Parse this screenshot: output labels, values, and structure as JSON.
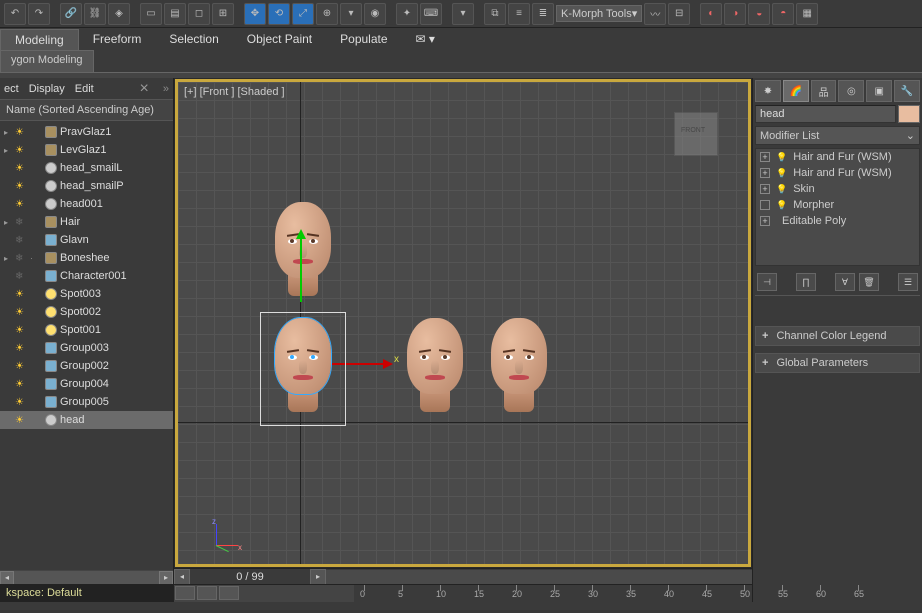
{
  "top_toolbar": {
    "dropdown": "K-Morph Tools"
  },
  "menubar": {
    "items": [
      "Modeling",
      "Freeform",
      "Selection",
      "Object Paint",
      "Populate"
    ]
  },
  "ribbon": {
    "tab": "ygon Modeling"
  },
  "left_panel": {
    "tabs": [
      "ect",
      "Display",
      "Edit"
    ],
    "header": "Name (Sorted Ascending Age)",
    "nodes": [
      {
        "name": "PravGlaz1",
        "icon": "bone",
        "bulb": "on",
        "exp": true
      },
      {
        "name": "LevGlaz1",
        "icon": "bone",
        "bulb": "on",
        "exp": true
      },
      {
        "name": "head_smailL",
        "icon": "geo",
        "bulb": "on",
        "exp": false
      },
      {
        "name": "head_smailP",
        "icon": "geo",
        "bulb": "on",
        "exp": false
      },
      {
        "name": "head001",
        "icon": "geo",
        "bulb": "on",
        "exp": false
      },
      {
        "name": "Hair",
        "icon": "bone",
        "bulb": "off",
        "exp": true
      },
      {
        "name": "Glavn",
        "icon": "grp",
        "bulb": "off",
        "exp": false
      },
      {
        "name": "Boneshee",
        "icon": "bone",
        "bulb": "off",
        "exp": true,
        "dim": true
      },
      {
        "name": "Character001",
        "icon": "grp",
        "bulb": "off",
        "exp": false
      },
      {
        "name": "Spot003",
        "icon": "spot",
        "bulb": "on",
        "exp": false
      },
      {
        "name": "Spot002",
        "icon": "spot",
        "bulb": "on",
        "exp": false
      },
      {
        "name": "Spot001",
        "icon": "spot",
        "bulb": "on",
        "exp": false
      },
      {
        "name": "Group003",
        "icon": "grp",
        "bulb": "on",
        "exp": false
      },
      {
        "name": "Group002",
        "icon": "grp",
        "bulb": "on",
        "exp": false
      },
      {
        "name": "Group004",
        "icon": "grp",
        "bulb": "on",
        "exp": false
      },
      {
        "name": "Group005",
        "icon": "grp",
        "bulb": "on",
        "exp": false
      },
      {
        "name": "head",
        "icon": "geo",
        "bulb": "on",
        "exp": false,
        "selected": true
      }
    ],
    "workspace": "kspace: Default"
  },
  "viewport": {
    "label": "[+] [Front ] [Shaded ]",
    "gizmo_label": "x"
  },
  "timeline": {
    "counter": "0 / 99",
    "ticks": [
      0,
      5,
      10,
      15,
      20,
      25,
      30,
      35,
      40,
      45,
      50,
      55,
      60,
      65
    ]
  },
  "right_panel": {
    "object_name": "head",
    "modifier_list_label": "Modifier List",
    "stack": [
      {
        "label": "Hair and Fur (WSM)",
        "exp": true,
        "bulb": true
      },
      {
        "label": "Hair and Fur (WSM)",
        "exp": true,
        "bulb": true
      },
      {
        "label": "Skin",
        "exp": true,
        "bulb": true
      },
      {
        "label": "Morpher",
        "exp": false,
        "bulb": true
      },
      {
        "label": "Editable Poly",
        "exp": true,
        "bulb": false
      }
    ],
    "rollouts": [
      "Channel Color Legend",
      "Global Parameters"
    ]
  }
}
